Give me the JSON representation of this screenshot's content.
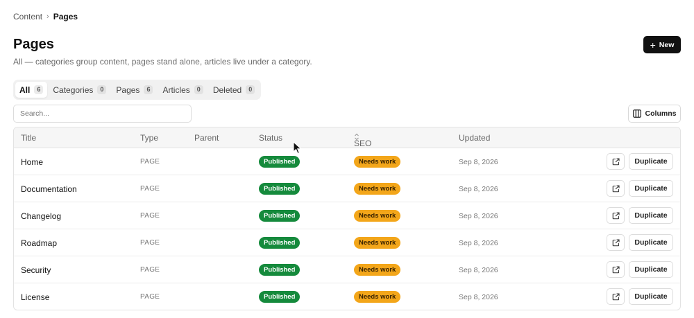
{
  "breadcrumb": {
    "parent": "Content",
    "separator": "›",
    "current": "Pages"
  },
  "header": {
    "title": "Pages",
    "subtitle": "All — categories group content, pages stand alone, articles live under a category.",
    "new_label": "New"
  },
  "tabs": [
    {
      "label": "All",
      "count": "6",
      "active": true
    },
    {
      "label": "Categories",
      "count": "0",
      "active": false
    },
    {
      "label": "Pages",
      "count": "6",
      "active": false
    },
    {
      "label": "Articles",
      "count": "0",
      "active": false
    },
    {
      "label": "Deleted",
      "count": "0",
      "active": false
    }
  ],
  "search": {
    "placeholder": "Search...",
    "value": ""
  },
  "columns_button": {
    "label": "Columns"
  },
  "table": {
    "headers": {
      "title": "Title",
      "type": "Type",
      "parent": "Parent",
      "status": "Status",
      "seo": "SEO",
      "updated": "Updated"
    },
    "rows": [
      {
        "title": "Home",
        "type": "PAGE",
        "parent": "",
        "status": "Published",
        "seo": "Needs work",
        "updated": "Sep 8, 2026",
        "action": "Duplicate"
      },
      {
        "title": "Documentation",
        "type": "PAGE",
        "parent": "",
        "status": "Published",
        "seo": "Needs work",
        "updated": "Sep 8, 2026",
        "action": "Duplicate"
      },
      {
        "title": "Changelog",
        "type": "PAGE",
        "parent": "",
        "status": "Published",
        "seo": "Needs work",
        "updated": "Sep 8, 2026",
        "action": "Duplicate"
      },
      {
        "title": "Roadmap",
        "type": "PAGE",
        "parent": "",
        "status": "Published",
        "seo": "Needs work",
        "updated": "Sep 8, 2026",
        "action": "Duplicate"
      },
      {
        "title": "Security",
        "type": "PAGE",
        "parent": "",
        "status": "Published",
        "seo": "Needs work",
        "updated": "Sep 8, 2026",
        "action": "Duplicate"
      },
      {
        "title": "License",
        "type": "PAGE",
        "parent": "",
        "status": "Published",
        "seo": "Needs work",
        "updated": "Sep 8, 2026",
        "action": "Duplicate"
      }
    ]
  },
  "colors": {
    "primary": "#111111",
    "published": "#158a3c",
    "needs_work": "#f3a61a",
    "header_bg": "#f6f6f6"
  },
  "icons": {
    "new": "plus-icon",
    "columns": "columns-icon",
    "seo_sort": "sort-icon",
    "open": "external-link-icon",
    "breadcrumb_sep": "chevron-right-icon"
  }
}
